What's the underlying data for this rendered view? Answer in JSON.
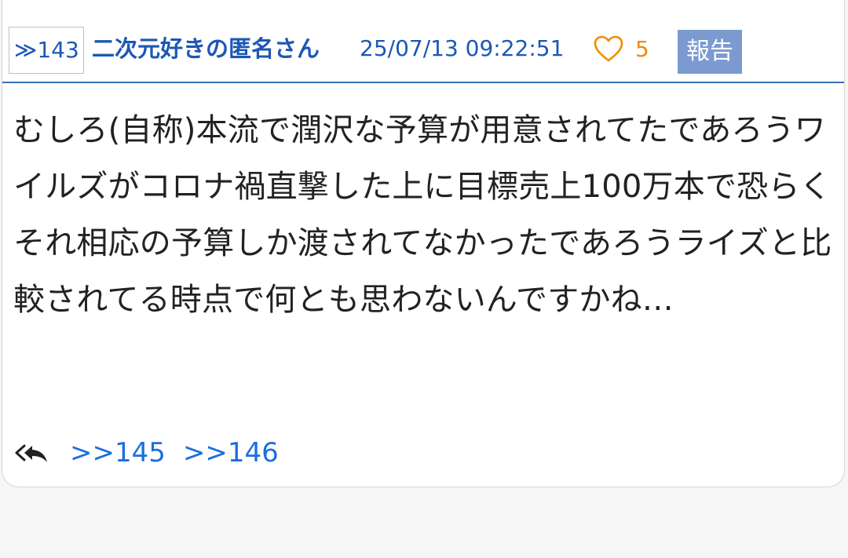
{
  "post": {
    "number_label": "≫143",
    "author": "二次元好きの匿名さん",
    "datetime": "25/07/13 09:22:51",
    "likes": "5",
    "report_label": "報告",
    "body": "むしろ(自称)本流で潤沢な予算が用意されてたであろうワイルズがコロナ禍直撃した上に目標売上100万本で恐らくそれ相応の予算しか渡されてなかったであろうライズと比較されてる時点で何とも思わないんですかね…",
    "replies": [
      ">>145",
      ">>146"
    ]
  },
  "colors": {
    "link_blue": "#1c57b5",
    "reply_blue": "#1b6fde",
    "like_orange": "#f08c00",
    "report_bg": "#7b9ad0",
    "header_rule": "#3a6fb0"
  },
  "icons": {
    "like": "heart-outline-icon",
    "reply": "reply-all-icon"
  }
}
